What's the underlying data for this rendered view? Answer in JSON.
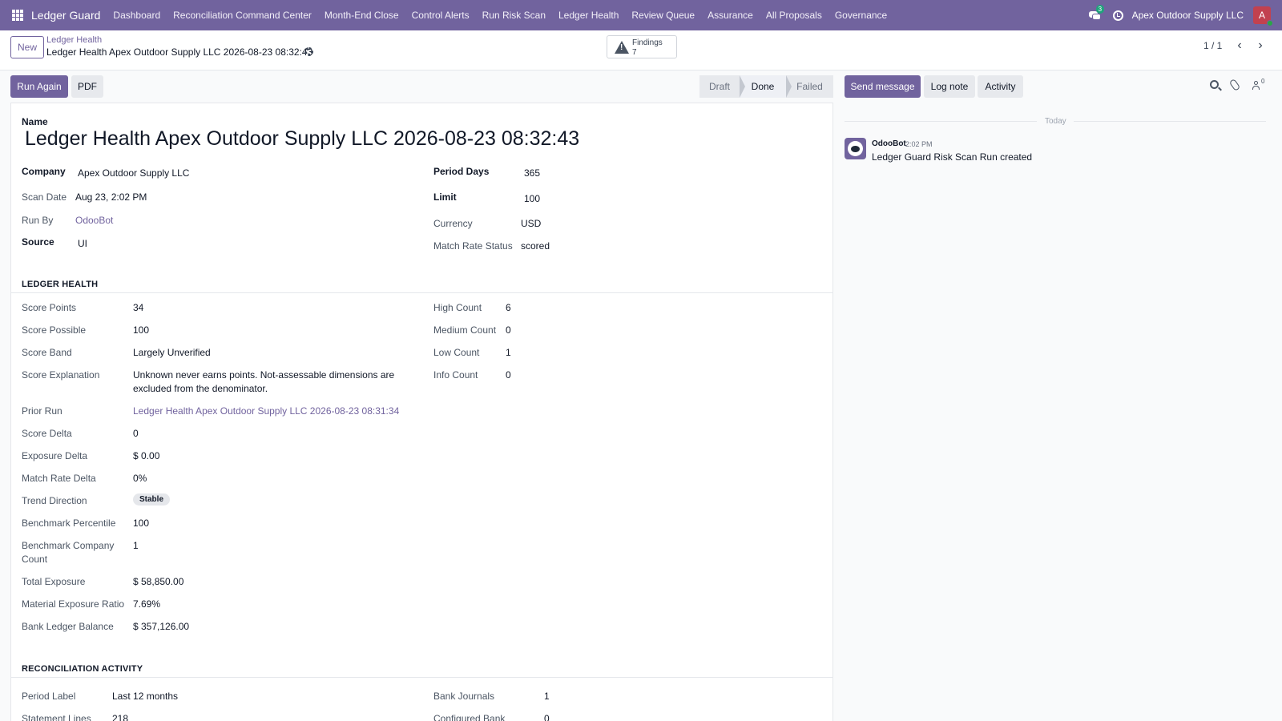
{
  "navbar": {
    "brand": "Ledger Guard",
    "menu": [
      "Dashboard",
      "Reconciliation Command Center",
      "Month-End Close",
      "Control Alerts",
      "Run Risk Scan",
      "Ledger Health",
      "Review Queue",
      "Assurance",
      "All Proposals",
      "Governance"
    ],
    "messages_count": "3",
    "company": "Apex Outdoor Supply LLC",
    "user_initial": "A"
  },
  "control": {
    "new_label": "New",
    "breadcrumb_parent": "Ledger Health",
    "breadcrumb_current": "Ledger Health Apex Outdoor Supply LLC 2026-08-23 08:32:43",
    "findings_label": "Findings",
    "findings_count": "7",
    "pager": "1 / 1"
  },
  "actions": {
    "run_again": "Run Again",
    "pdf": "PDF",
    "stages": [
      "Draft",
      "Done",
      "Failed"
    ],
    "active_stage": "Done"
  },
  "form": {
    "name_label": "Name",
    "name": "Ledger Health Apex Outdoor Supply LLC 2026-08-23 08:32:43",
    "company_label": "Company",
    "company": "Apex Outdoor Supply LLC",
    "scan_date_label": "Scan Date",
    "scan_date": "Aug 23, 2:02 PM",
    "run_by_label": "Run By",
    "run_by": "OdooBot",
    "source_label": "Source",
    "source": "UI",
    "period_days_label": "Period Days",
    "period_days": "365",
    "limit_label": "Limit",
    "limit": "100",
    "currency_label": "Currency",
    "currency": "USD",
    "match_rate_status_label": "Match Rate Status",
    "match_rate_status": "scored"
  },
  "ledger_health": {
    "title": "LEDGER HEALTH",
    "score_points_label": "Score Points",
    "score_points": "34",
    "score_possible_label": "Score Possible",
    "score_possible": "100",
    "score_band_label": "Score Band",
    "score_band": "Largely Unverified",
    "score_explanation_label": "Score Explanation",
    "score_explanation_1": "Unknown never earns points. Not-assessable dimensions are",
    "score_explanation_2": "excluded from the denominator.",
    "prior_run_label": "Prior Run",
    "prior_run": "Ledger Health Apex Outdoor Supply LLC 2026-08-23 08:31:34",
    "score_delta_label": "Score Delta",
    "score_delta": "0",
    "exposure_delta_label": "Exposure Delta",
    "exposure_delta": "$ 0.00",
    "match_rate_delta_label": "Match Rate Delta",
    "match_rate_delta": "0%",
    "trend_direction_label": "Trend Direction",
    "trend_direction": "Stable",
    "benchmark_percentile_label": "Benchmark Percentile",
    "benchmark_percentile": "100",
    "benchmark_company_count_label_1": "Benchmark Company",
    "benchmark_company_count_label_2": "Count",
    "benchmark_company_count": "1",
    "total_exposure_label": "Total Exposure",
    "total_exposure": "$ 58,850.00",
    "material_exposure_ratio_label": "Material Exposure Ratio",
    "material_exposure_ratio": "7.69%",
    "bank_ledger_balance_label": "Bank Ledger Balance",
    "bank_ledger_balance": "$ 357,126.00",
    "high_count_label": "High Count",
    "high_count": "6",
    "medium_count_label": "Medium Count",
    "medium_count": "0",
    "low_count_label": "Low Count",
    "low_count": "1",
    "info_count_label": "Info Count",
    "info_count": "0"
  },
  "reconciliation": {
    "title": "RECONCILIATION ACTIVITY",
    "period_label_label": "Period Label",
    "period_label": "Last 12 months",
    "statement_lines_label": "Statement Lines",
    "statement_lines": "218",
    "bank_journals_label": "Bank Journals",
    "bank_journals": "1",
    "configured_bank_label": "Configured Bank",
    "configured_bank": "0"
  },
  "chatter": {
    "send_message": "Send message",
    "log_note": "Log note",
    "activity": "Activity",
    "followers_count": "0",
    "today": "Today",
    "author": "OdooBot",
    "time": "2:02 PM",
    "message": "Ledger Guard Risk Scan Run created"
  }
}
